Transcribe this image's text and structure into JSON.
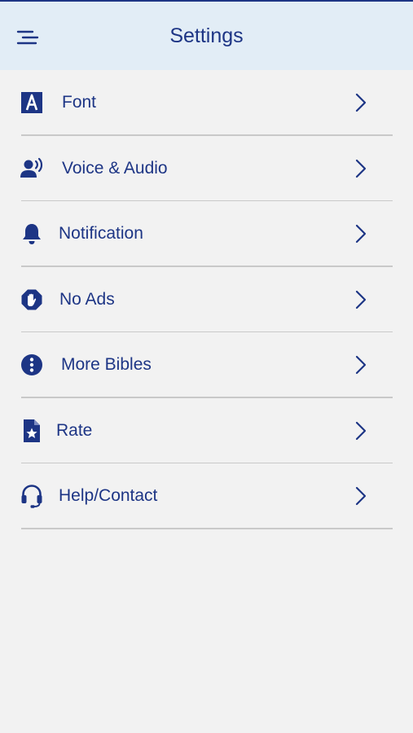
{
  "header": {
    "title": "Settings"
  },
  "colors": {
    "accent": "#1d3585",
    "header_bg": "#e2edf6",
    "background": "#f2f2f2",
    "divider": "#c9c9c9"
  },
  "settings": {
    "items": [
      {
        "label": "Font",
        "icon": "font-icon"
      },
      {
        "label": "Voice & Audio",
        "icon": "voice-audio-icon"
      },
      {
        "label": "Notification",
        "icon": "bell-icon"
      },
      {
        "label": "No Ads",
        "icon": "hand-stop-icon"
      },
      {
        "label": "More Bibles",
        "icon": "info-icon"
      },
      {
        "label": "Rate",
        "icon": "star-document-icon"
      },
      {
        "label": "Help/Contact",
        "icon": "headset-icon"
      }
    ]
  }
}
